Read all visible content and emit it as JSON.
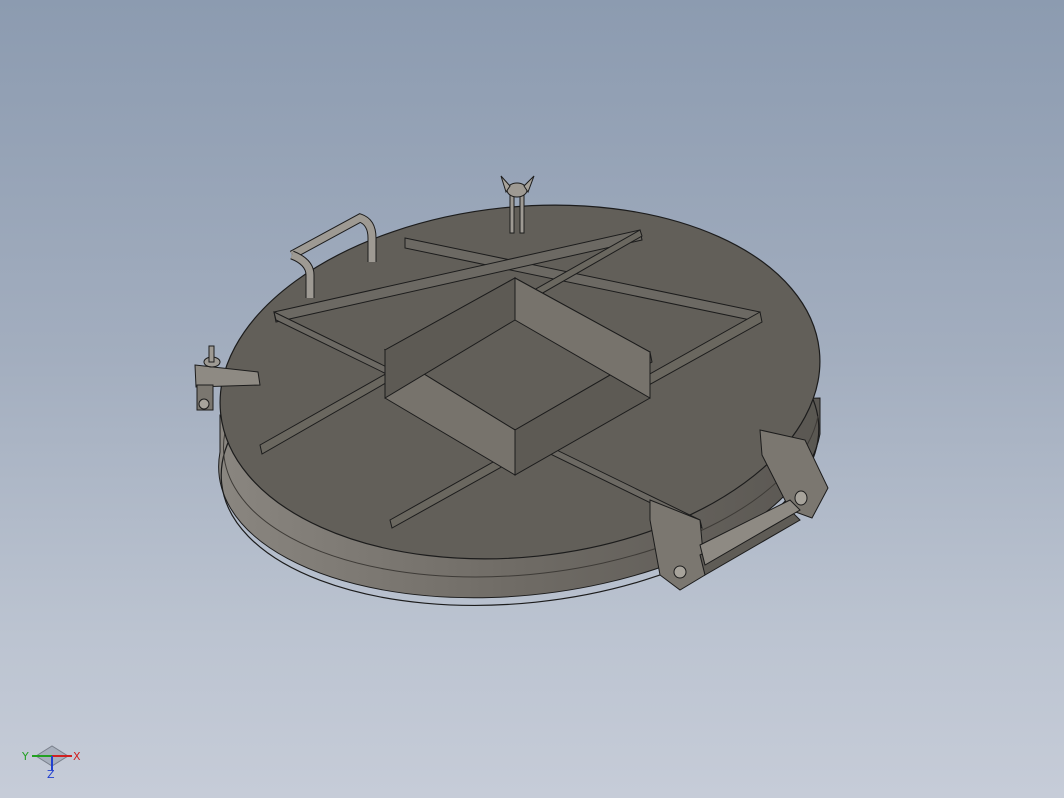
{
  "viewport": {
    "background_top": "#8c9bb0",
    "background_bottom": "#c6ccd8"
  },
  "model": {
    "face_color": "#625f59",
    "side_color": "#7b7770",
    "edge_color": "#1c1c1c"
  },
  "triad": {
    "x_label": "X",
    "y_label": "Y",
    "z_label": "Z",
    "x_color": "#d02020",
    "y_color": "#22a022",
    "z_color": "#2040d0"
  }
}
